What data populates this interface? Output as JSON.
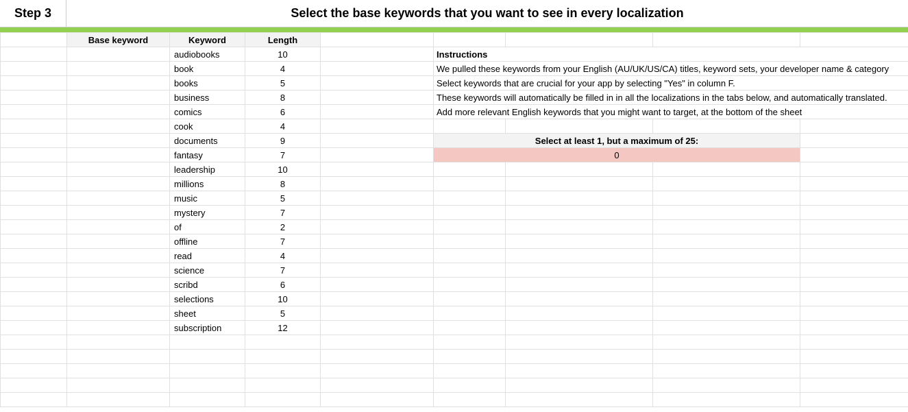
{
  "header": {
    "step": "Step 3",
    "title": "Select the base keywords that you want to see in every localization"
  },
  "columns": {
    "base_keyword": "Base keyword",
    "keyword": "Keyword",
    "length": "Length"
  },
  "keywords": [
    {
      "keyword": "audiobooks",
      "length": "10"
    },
    {
      "keyword": "book",
      "length": "4"
    },
    {
      "keyword": "books",
      "length": "5"
    },
    {
      "keyword": "business",
      "length": "8"
    },
    {
      "keyword": "comics",
      "length": "6"
    },
    {
      "keyword": "cook",
      "length": "4"
    },
    {
      "keyword": "documents",
      "length": "9"
    },
    {
      "keyword": "fantasy",
      "length": "7"
    },
    {
      "keyword": "leadership",
      "length": "10"
    },
    {
      "keyword": "millions",
      "length": "8"
    },
    {
      "keyword": "music",
      "length": "5"
    },
    {
      "keyword": "mystery",
      "length": "7"
    },
    {
      "keyword": "of",
      "length": "2"
    },
    {
      "keyword": "offline",
      "length": "7"
    },
    {
      "keyword": "read",
      "length": "4"
    },
    {
      "keyword": "science",
      "length": "7"
    },
    {
      "keyword": "scribd",
      "length": "6"
    },
    {
      "keyword": "selections",
      "length": "10"
    },
    {
      "keyword": "sheet",
      "length": "5"
    },
    {
      "keyword": "subscription",
      "length": "12"
    }
  ],
  "instructions": {
    "header": "Instructions",
    "lines": [
      "We pulled these keywords from your English (AU/UK/US/CA) titles, keyword sets, your developer name & category",
      "Select keywords that are crucial for your app by selecting \"Yes\" in column F.",
      "These keywords will automatically be filled in in all the localizations in the tabs below, and automatically translated.",
      "Add more relevant English keywords that you might want to target, at the bottom of the sheet"
    ],
    "select_header": "Select at least 1, but a maximum of 25:",
    "count": "0"
  }
}
